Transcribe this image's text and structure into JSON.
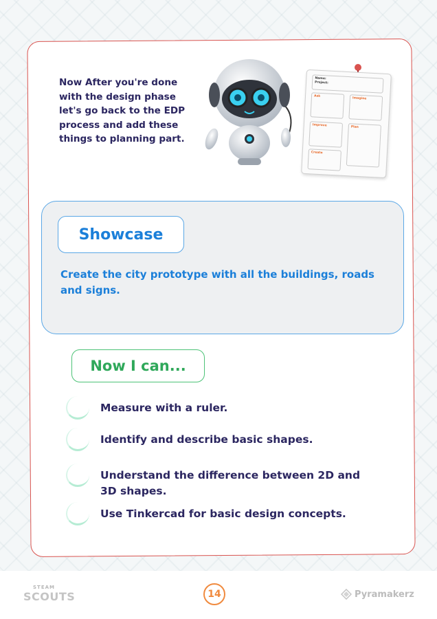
{
  "intro": {
    "text": "Now After you're done with the design phase let's go back to the EDP process and add these things to planning part."
  },
  "plan_sheet": {
    "header_line1": "Name:",
    "header_line2": "Project:",
    "boxes": [
      "Ask",
      "Imagine",
      "Improve",
      "Plan",
      "Create"
    ]
  },
  "showcase": {
    "title": "Showcase",
    "text": "Create the city prototype with all the buildings, roads and signs."
  },
  "now_i_can": {
    "title": "Now I can...",
    "items": [
      "Measure with a ruler.",
      "Identify and describe basic shapes.",
      "Understand the difference between 2D and 3D shapes.",
      "Use Tinkercad for basic design concepts."
    ]
  },
  "footer": {
    "logo_left_top": "STEAM",
    "logo_left_bottom": "SCOUTS",
    "page_number": "14",
    "logo_right": "Pyramakerz"
  },
  "colors": {
    "card_border": "#d9534f",
    "showcase_blue": "#1b7fd9",
    "can_green": "#2fa85a",
    "text_navy": "#2b2660",
    "page_orange": "#f08a3e"
  }
}
